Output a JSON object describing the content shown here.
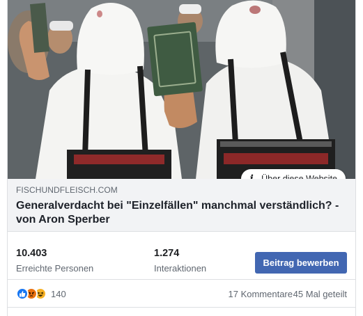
{
  "link_preview": {
    "domain": "FISCHUNDFLEISCH.COM",
    "title": "Generalverdacht bei \"Einzelfällen\" manchmal verständlich? - von Aron Sperber",
    "about_label": "Über diese Website",
    "info_icon": "i"
  },
  "insights": {
    "reach_value": "10.403",
    "reach_label": "Erreichte Personen",
    "engagement_value": "1.274",
    "engagement_label": "Interaktionen",
    "boost_label": "Beitrag bewerben"
  },
  "reactions": {
    "icons": [
      "like-icon",
      "angry-icon",
      "haha-icon"
    ],
    "count": "140",
    "comments": "17 Kommentare",
    "shares": "45 Mal geteilt"
  },
  "colors": {
    "boost_button": "#4267b2",
    "like": "#1877f2",
    "angry": "#e9710f",
    "haha": "#f7b125",
    "meta_background": "#f2f3f5"
  }
}
